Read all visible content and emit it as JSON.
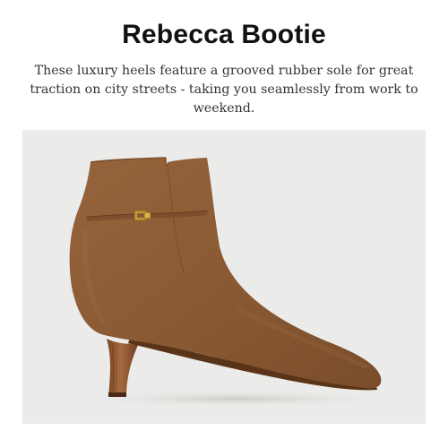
{
  "product": {
    "title": "Rebecca Bootie",
    "description": "These luxury heels feature a grooved rubber sole for great traction on city streets - taking you seamlessly from work to weekend."
  },
  "image": {
    "subject": "boot-image",
    "background_color": "#ebebe9",
    "suede_color": "#8a5a34",
    "heel_color": "#8a5530",
    "buckle_color": "#c49a3a"
  }
}
